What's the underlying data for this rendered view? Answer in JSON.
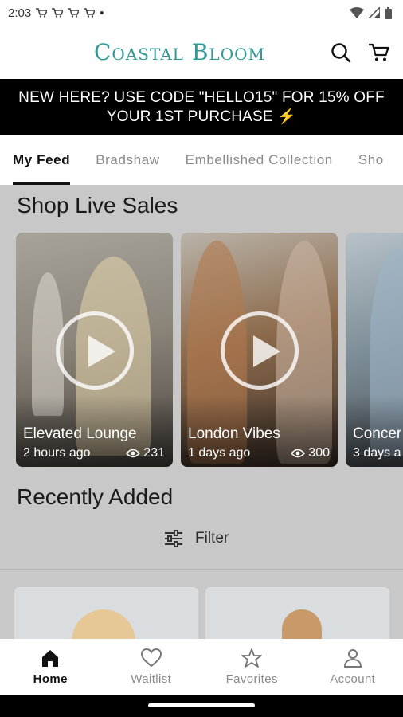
{
  "status_bar": {
    "time": "2:03",
    "dot": "•"
  },
  "header": {
    "logo": "Coastal Bloom"
  },
  "promo": {
    "line1": "NEW HERE? USE CODE \"HELLO15\" FOR 15% OFF",
    "line2": "YOUR 1ST PURCHASE ⚡"
  },
  "tabs": [
    {
      "label": "My Feed"
    },
    {
      "label": "Bradshaw"
    },
    {
      "label": "Embellished Collection"
    },
    {
      "label": "Sho"
    }
  ],
  "live_sales": {
    "title": "Shop Live Sales",
    "cards": [
      {
        "title": "Elevated Lounge",
        "time": "2 hours ago",
        "views": "231"
      },
      {
        "title": "London Vibes",
        "time": "1 days ago",
        "views": "300"
      },
      {
        "title": "Concer",
        "time": "3 days a"
      }
    ]
  },
  "recent": {
    "title": "Recently Added",
    "filter_label": "Filter"
  },
  "bottom_nav": [
    {
      "label": "Home",
      "icon": "home-icon"
    },
    {
      "label": "Waitlist",
      "icon": "heart-icon"
    },
    {
      "label": "Favorites",
      "icon": "star-icon"
    },
    {
      "label": "Account",
      "icon": "person-icon"
    }
  ],
  "colors": {
    "logo": "#2f9a96",
    "promo_bg": "#000000",
    "overlay": "#c8c8c8"
  }
}
